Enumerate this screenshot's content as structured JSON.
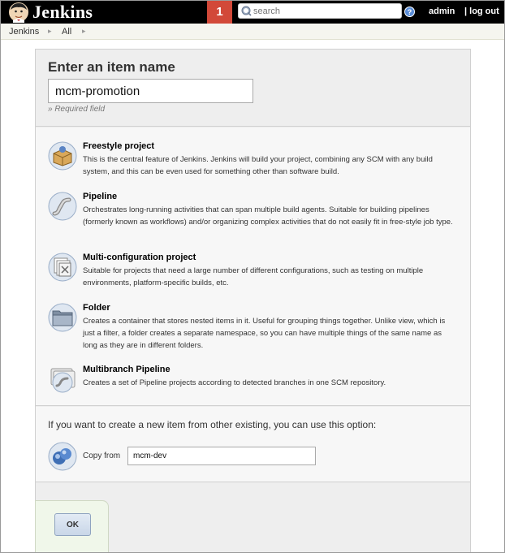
{
  "header": {
    "app_name": "Jenkins",
    "notification_count": "1",
    "search_placeholder": "search",
    "help_label": "?",
    "user": "admin",
    "logout": "| log out"
  },
  "breadcrumb": [
    "Jenkins",
    "All"
  ],
  "new_item": {
    "heading": "Enter an item name",
    "name_value": "mcm-promotion",
    "required_note": "» Required field"
  },
  "item_types": [
    {
      "title": "Freestyle project",
      "description": "This is the central feature of Jenkins. Jenkins will build your project, combining any SCM with any build system, and this can be even used for something other than software build.",
      "icon": "freestyle-project-icon"
    },
    {
      "title": "Pipeline",
      "description": "Orchestrates long-running activities that can span multiple build agents. Suitable for building pipelines (formerly known as workflows) and/or organizing complex activities that do not easily fit in free-style job type.",
      "icon": "pipeline-icon"
    },
    {
      "title": "Multi-configuration project",
      "description": "Suitable for projects that need a large number of different configurations, such as testing on multiple environments, platform-specific builds, etc.",
      "icon": "multi-configuration-icon"
    },
    {
      "title": "Folder",
      "description": "Creates a container that stores nested items in it. Useful for grouping things together. Unlike view, which is just a filter, a folder creates a separate namespace, so you can have multiple things of the same name as long as they are in different folders.",
      "icon": "folder-icon"
    },
    {
      "title": "Multibranch Pipeline",
      "description": "Creates a set of Pipeline projects according to detected branches in one SCM repository.",
      "icon": "multibranch-pipeline-icon"
    }
  ],
  "copy": {
    "heading": "If you want to create a new item from other existing, you can use this option:",
    "label": "Copy from",
    "value": "mcm-dev"
  },
  "ok_label": "OK",
  "colors": {
    "header_bg": "#000000",
    "badge": "#d24939",
    "panel_bg": "#eeeeee"
  }
}
